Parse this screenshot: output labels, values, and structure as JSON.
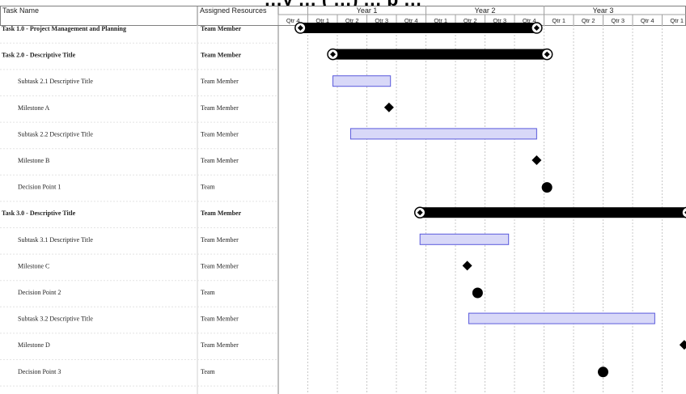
{
  "page": {
    "title": "…y … ( …) … p …"
  },
  "headers": {
    "task_name": "Task Name",
    "resources": "Assigned Resources"
  },
  "timescale": {
    "years": [
      "Year 1",
      "Year 2",
      "Year 3"
    ],
    "quarters": [
      "Qtr 4",
      "Qtr 1",
      "Qtr 2",
      "Qtr 3",
      "Qtr 4",
      "Qtr 1",
      "Qtr 2",
      "Qtr 3",
      "Qtr 4",
      "Qtr 1",
      "Qtr 2",
      "Qtr 3",
      "Qtr 4",
      "Qtr 1"
    ]
  },
  "colors": {
    "summary_bar": "#000000",
    "task_fill": "#d8d8f8",
    "task_border": "#5a5adc",
    "milestone": "#000000",
    "grid": "#c8c8c8"
  },
  "chart_data": {
    "type": "gantt",
    "time_unit": "quarter index (0 = start of first Qtr 4 column)",
    "x_range": [
      0,
      14
    ],
    "tasks": [
      {
        "name": "Task 1.0 - Project Management and Planning",
        "resource": "Team Member",
        "kind": "summary",
        "start": 0.75,
        "end": 8.75,
        "bold": true
      },
      {
        "name": "Task 2.0 - Descriptive Title",
        "resource": "Team Member",
        "kind": "summary",
        "start": 1.85,
        "end": 9.1,
        "bold": true
      },
      {
        "name": "Subtask 2.1 Descriptive Title",
        "resource": "Team Member",
        "kind": "task",
        "start": 1.85,
        "end": 3.8,
        "bold": false
      },
      {
        "name": "Milestone A",
        "resource": "Team Member",
        "kind": "milestone",
        "at": 3.75,
        "bold": false
      },
      {
        "name": "Subtask 2.2 Descriptive Title",
        "resource": "Team Member",
        "kind": "task",
        "start": 2.45,
        "end": 8.75,
        "bold": false
      },
      {
        "name": "Milestone B",
        "resource": "Team Member",
        "kind": "milestone",
        "at": 8.75,
        "bold": false
      },
      {
        "name": "Decision Point 1",
        "resource": "Team",
        "kind": "decision",
        "at": 9.1,
        "bold": false
      },
      {
        "name": "Task 3.0 - Descriptive Title",
        "resource": "Team Member",
        "kind": "summary",
        "start": 4.8,
        "end": 13.85,
        "bold": true
      },
      {
        "name": "Subtask 3.1 Descriptive Title",
        "resource": "Team Member",
        "kind": "task",
        "start": 4.8,
        "end": 7.8,
        "bold": false
      },
      {
        "name": "Milestone C",
        "resource": "Team Member",
        "kind": "milestone",
        "at": 6.4,
        "bold": false
      },
      {
        "name": "Decision Point 2",
        "resource": "Team",
        "kind": "decision",
        "at": 6.75,
        "bold": false
      },
      {
        "name": "Subtask 3.2 Descriptive Title",
        "resource": "Team Member",
        "kind": "task",
        "start": 6.45,
        "end": 12.75,
        "bold": false
      },
      {
        "name": "Milestone D",
        "resource": "Team Member",
        "kind": "milestone",
        "at": 13.75,
        "bold": false
      },
      {
        "name": "Decision Point 3",
        "resource": "Team",
        "kind": "decision",
        "at": 11.0,
        "bold": false
      }
    ]
  }
}
